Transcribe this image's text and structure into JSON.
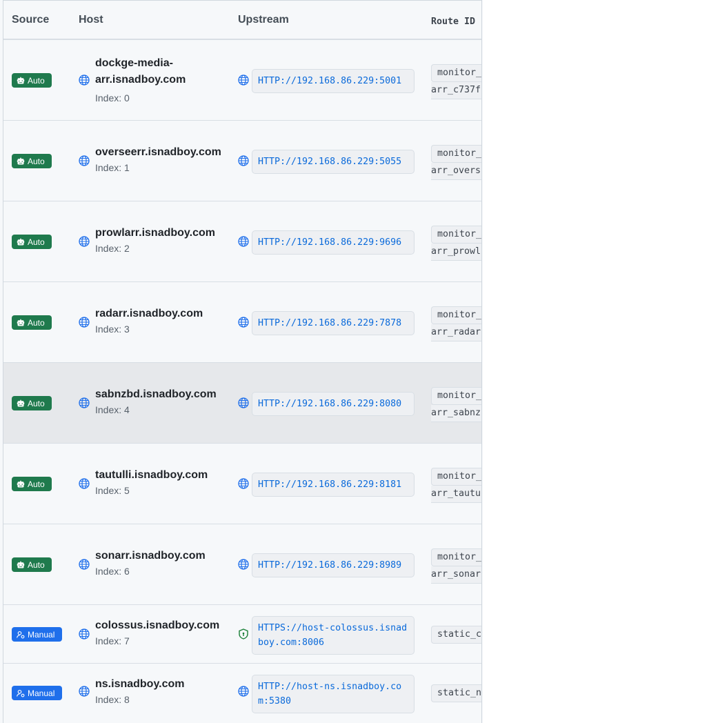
{
  "table": {
    "headers": {
      "source": "Source",
      "host": "Host",
      "upstream": "Upstream",
      "route_id": "Route ID"
    },
    "rows": [
      {
        "source": "Auto",
        "host_line1": "dockge-media-",
        "host_line2": "arr.isnadboy.com",
        "index": "Index: 0",
        "upstream": "HTTP://192.168.86.229:5001",
        "upstream_icon": "globe-icon",
        "route1": "monitor_",
        "route2": "arr_c737f"
      },
      {
        "source": "Auto",
        "host_line1": "overseerr.isnadboy.com",
        "index": "Index: 1",
        "upstream": "HTTP://192.168.86.229:5055",
        "upstream_icon": "globe-icon",
        "route1": "monitor_",
        "route2": "arr_overs"
      },
      {
        "source": "Auto",
        "host_line1": "prowlarr.isnadboy.com",
        "index": "Index: 2",
        "upstream": "HTTP://192.168.86.229:9696",
        "upstream_icon": "globe-icon",
        "route1": "monitor_",
        "route2": "arr_prowl"
      },
      {
        "source": "Auto",
        "host_line1": "radarr.isnadboy.com",
        "index": "Index: 3",
        "upstream": "HTTP://192.168.86.229:7878",
        "upstream_icon": "globe-icon",
        "route1": "monitor_",
        "route2": "arr_radar"
      },
      {
        "source": "Auto",
        "host_line1": "sabnzbd.isnadboy.com",
        "index": "Index: 4",
        "upstream": "HTTP://192.168.86.229:8080",
        "upstream_icon": "globe-icon",
        "route1": "monitor_",
        "route2": "arr_sabnz"
      },
      {
        "source": "Auto",
        "host_line1": "tautulli.isnadboy.com",
        "index": "Index: 5",
        "upstream": "HTTP://192.168.86.229:8181",
        "upstream_icon": "globe-icon",
        "route1": "monitor_",
        "route2": "arr_tautu"
      },
      {
        "source": "Auto",
        "host_line1": "sonarr.isnadboy.com",
        "index": "Index: 6",
        "upstream": "HTTP://192.168.86.229:8989",
        "upstream_icon": "globe-icon",
        "route1": "monitor_",
        "route2": "arr_sonar"
      },
      {
        "source": "Manual",
        "host_line1": "colossus.isnadboy.com",
        "index": "Index: 7",
        "upstream": "HTTPS://host-colossus.isnadboy.com:8006",
        "upstream_icon": "shield-icon",
        "route1": "static_c"
      },
      {
        "source": "Manual",
        "host_line1": "ns.isnadboy.com",
        "index": "Index: 8",
        "upstream": "HTTP://host-ns.isnadboy.com:5380",
        "upstream_icon": "globe-icon",
        "route1": "static_n"
      }
    ]
  },
  "colors": {
    "auto_badge": "#1f7a4d",
    "manual_badge": "#1f6feb",
    "link": "#0969da",
    "highlight_row": "#e6e8eb"
  }
}
